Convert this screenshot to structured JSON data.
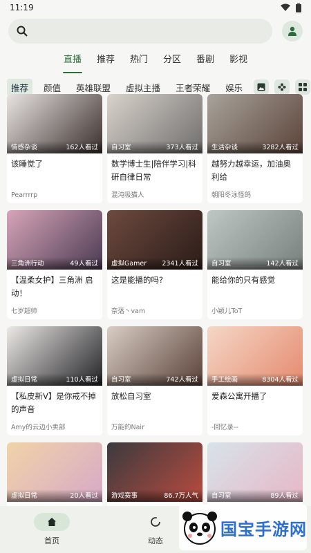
{
  "status": {
    "time": "11:19"
  },
  "search": {
    "placeholder": ""
  },
  "top_tabs": [
    {
      "label": "直播",
      "active": true
    },
    {
      "label": "推荐"
    },
    {
      "label": "热门"
    },
    {
      "label": "分区"
    },
    {
      "label": "番剧"
    },
    {
      "label": "影视"
    }
  ],
  "categories": [
    {
      "label": "推荐",
      "active": true
    },
    {
      "label": "颜值"
    },
    {
      "label": "英雄联盟"
    },
    {
      "label": "虚拟主播"
    },
    {
      "label": "王者荣耀"
    },
    {
      "label": "娱乐"
    }
  ],
  "category_icons": [
    "image-icon",
    "gamepad-icon",
    "grid-icon"
  ],
  "cards": [
    {
      "tag": "情感杂谈",
      "views": "162人看过",
      "title": "该睡觉了",
      "author": "Pearrrrp",
      "thumb_colors": [
        "#e9e4e2",
        "#3a2f2c"
      ]
    },
    {
      "tag": "自习室",
      "views": "373人看过",
      "title": "数学博士生|陪伴学习|科研自律日常",
      "author": "混沌吸猫人",
      "thumb_colors": [
        "#d9d3cc",
        "#6f6d6c"
      ]
    },
    {
      "tag": "生活杂谈",
      "views": "3282人看过",
      "title": "越努力越幸运，加油奥利给",
      "author": "朝阳冬泳怪鸽",
      "thumb_colors": [
        "#a8a39c",
        "#5b4338"
      ]
    },
    {
      "tag": "三角洲行动",
      "views": "49人看过",
      "title": "【温柔女护】三角洲 启动！",
      "author": "七岁超帅",
      "thumb_colors": [
        "#d7a4b8",
        "#4a3b52"
      ]
    },
    {
      "tag": "虚拟Gamer",
      "views": "2341人看过",
      "title": "这是能播的吗?",
      "author": "奈落丶vam",
      "thumb_colors": [
        "#6d4a3f",
        "#2b1c18"
      ]
    },
    {
      "tag": "自习室",
      "views": "142人看过",
      "title": "能给你的只有感觉",
      "author": "小颖儿ToT",
      "thumb_colors": [
        "#bfc7c5",
        "#77807c"
      ]
    },
    {
      "tag": "虚拟日常",
      "views": "110人看过",
      "title": "【私皮新V】是你戒不掉的声音",
      "author": "Amy的云边小卖部",
      "thumb_colors": [
        "#ece9e6",
        "#222226"
      ]
    },
    {
      "tag": "自习室",
      "views": "742人看过",
      "title": "放松自习室",
      "author": "万能的Nair",
      "thumb_colors": [
        "#d8cdc4",
        "#5a4138"
      ]
    },
    {
      "tag": "手工绘画",
      "views": "8304人看过",
      "title": "爱森公寓开播了",
      "author": "-回忆录--",
      "thumb_colors": [
        "#f4d7c6",
        "#e58a6e"
      ]
    },
    {
      "tag": "虚拟日常",
      "views": "20人看过",
      "title": "",
      "author": "",
      "thumb_colors": [
        "#f0d3a8",
        "#d7a9c7"
      ]
    },
    {
      "tag": "游戏赛事",
      "views": "86.7万人气",
      "title": "",
      "author": "",
      "thumb_colors": [
        "#3b3a3f",
        "#b94b3f"
      ]
    },
    {
      "tag": "自习室",
      "views": "89人看过",
      "title": "",
      "author": "",
      "thumb_colors": [
        "#d7e3ea",
        "#e7b7c6"
      ]
    }
  ],
  "bottom_nav": [
    {
      "label": "首页",
      "icon": "home-icon",
      "active": true
    },
    {
      "label": "动态",
      "icon": "refresh-icon"
    }
  ],
  "watermark": {
    "text": "国宝手游网"
  },
  "colors": {
    "accent": "#2e6b3a",
    "background": "#f6f7f4"
  }
}
